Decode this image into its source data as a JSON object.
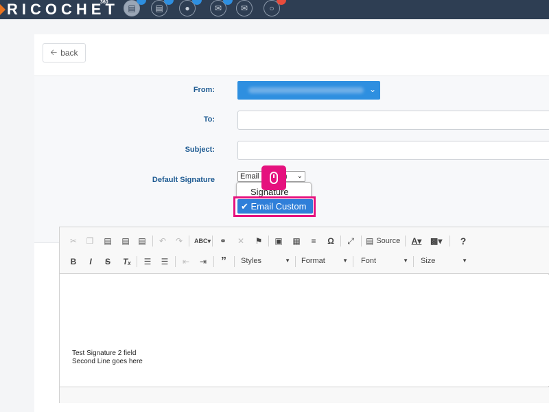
{
  "app": {
    "logo_text": "RICOCHET",
    "logo_sup": "360"
  },
  "topnav": {
    "items": [
      {
        "icon": "document-icon",
        "badge": "",
        "active": true
      },
      {
        "icon": "file-icon",
        "badge": ""
      },
      {
        "icon": "chat-icon",
        "badge": ""
      },
      {
        "icon": "mail-icon",
        "badge": ""
      },
      {
        "icon": "envelope-open-icon",
        "badge": ""
      },
      {
        "icon": "speech-bubble-icon",
        "badge": "",
        "badge_color": "#e74c3c"
      }
    ]
  },
  "page": {
    "back_label": "back"
  },
  "form": {
    "from_label": "From:",
    "to_label": "To:",
    "subject_label": "Subject:",
    "signature_label": "Default Signature",
    "signature_select_value": "Email Custom",
    "signature_options": [
      "Signature",
      "Email Custom"
    ],
    "selected_option": "✔ Email Custom"
  },
  "editor": {
    "row1": [
      {
        "name": "cut-icon",
        "glyph": "✂",
        "dim": true
      },
      {
        "name": "copy-icon",
        "glyph": "❐",
        "dim": true
      },
      {
        "name": "paste-icon",
        "glyph": "📋"
      },
      {
        "name": "paste-text-icon",
        "glyph": "📋"
      },
      {
        "name": "paste-word-icon",
        "glyph": "📋"
      },
      {
        "name": "undo-icon",
        "glyph": "↶",
        "dim": true
      },
      {
        "name": "redo-icon",
        "glyph": "↷",
        "dim": true
      },
      {
        "name": "spellcheck-icon",
        "glyph": "ABC▾"
      },
      {
        "name": "link-icon",
        "glyph": "🔗"
      },
      {
        "name": "unlink-icon",
        "glyph": "✕",
        "dim": true
      },
      {
        "name": "anchor-flag-icon",
        "glyph": "⚑"
      },
      {
        "name": "image-icon",
        "glyph": "▣"
      },
      {
        "name": "table-icon",
        "glyph": "▦"
      },
      {
        "name": "horizontal-line-icon",
        "glyph": "≡"
      },
      {
        "name": "special-char-icon",
        "glyph": "Ω"
      },
      {
        "name": "maximize-icon",
        "glyph": "⤢"
      },
      {
        "name": "source-icon",
        "glyph": "▤"
      },
      {
        "name": "text-color-icon",
        "glyph": "A▾"
      },
      {
        "name": "bg-color-icon",
        "glyph": "A▾"
      },
      {
        "name": "help-icon",
        "glyph": "?"
      }
    ],
    "source_label": "Source",
    "row2": [
      {
        "name": "bold-icon",
        "glyph": "B"
      },
      {
        "name": "italic-icon",
        "glyph": "I"
      },
      {
        "name": "strike-icon",
        "glyph": "S"
      },
      {
        "name": "remove-format-icon",
        "glyph": "Tₓ"
      },
      {
        "name": "numbered-list-icon",
        "glyph": "☰"
      },
      {
        "name": "bullet-list-icon",
        "glyph": "☰"
      },
      {
        "name": "outdent-icon",
        "glyph": "⇤"
      },
      {
        "name": "indent-icon",
        "glyph": "⇥"
      },
      {
        "name": "blockquote-icon",
        "glyph": "”"
      }
    ],
    "styles_label": "Styles",
    "format_label": "Format",
    "font_label": "Font",
    "size_label": "Size",
    "body_lines": [
      "Test Signature 2 field",
      "Second Line goes here"
    ]
  },
  "colors": {
    "topbar": "#2e3e53",
    "accent_blue": "#2e8fe0",
    "highlight_pink": "#e5117e",
    "label_blue": "#1d5a91"
  }
}
